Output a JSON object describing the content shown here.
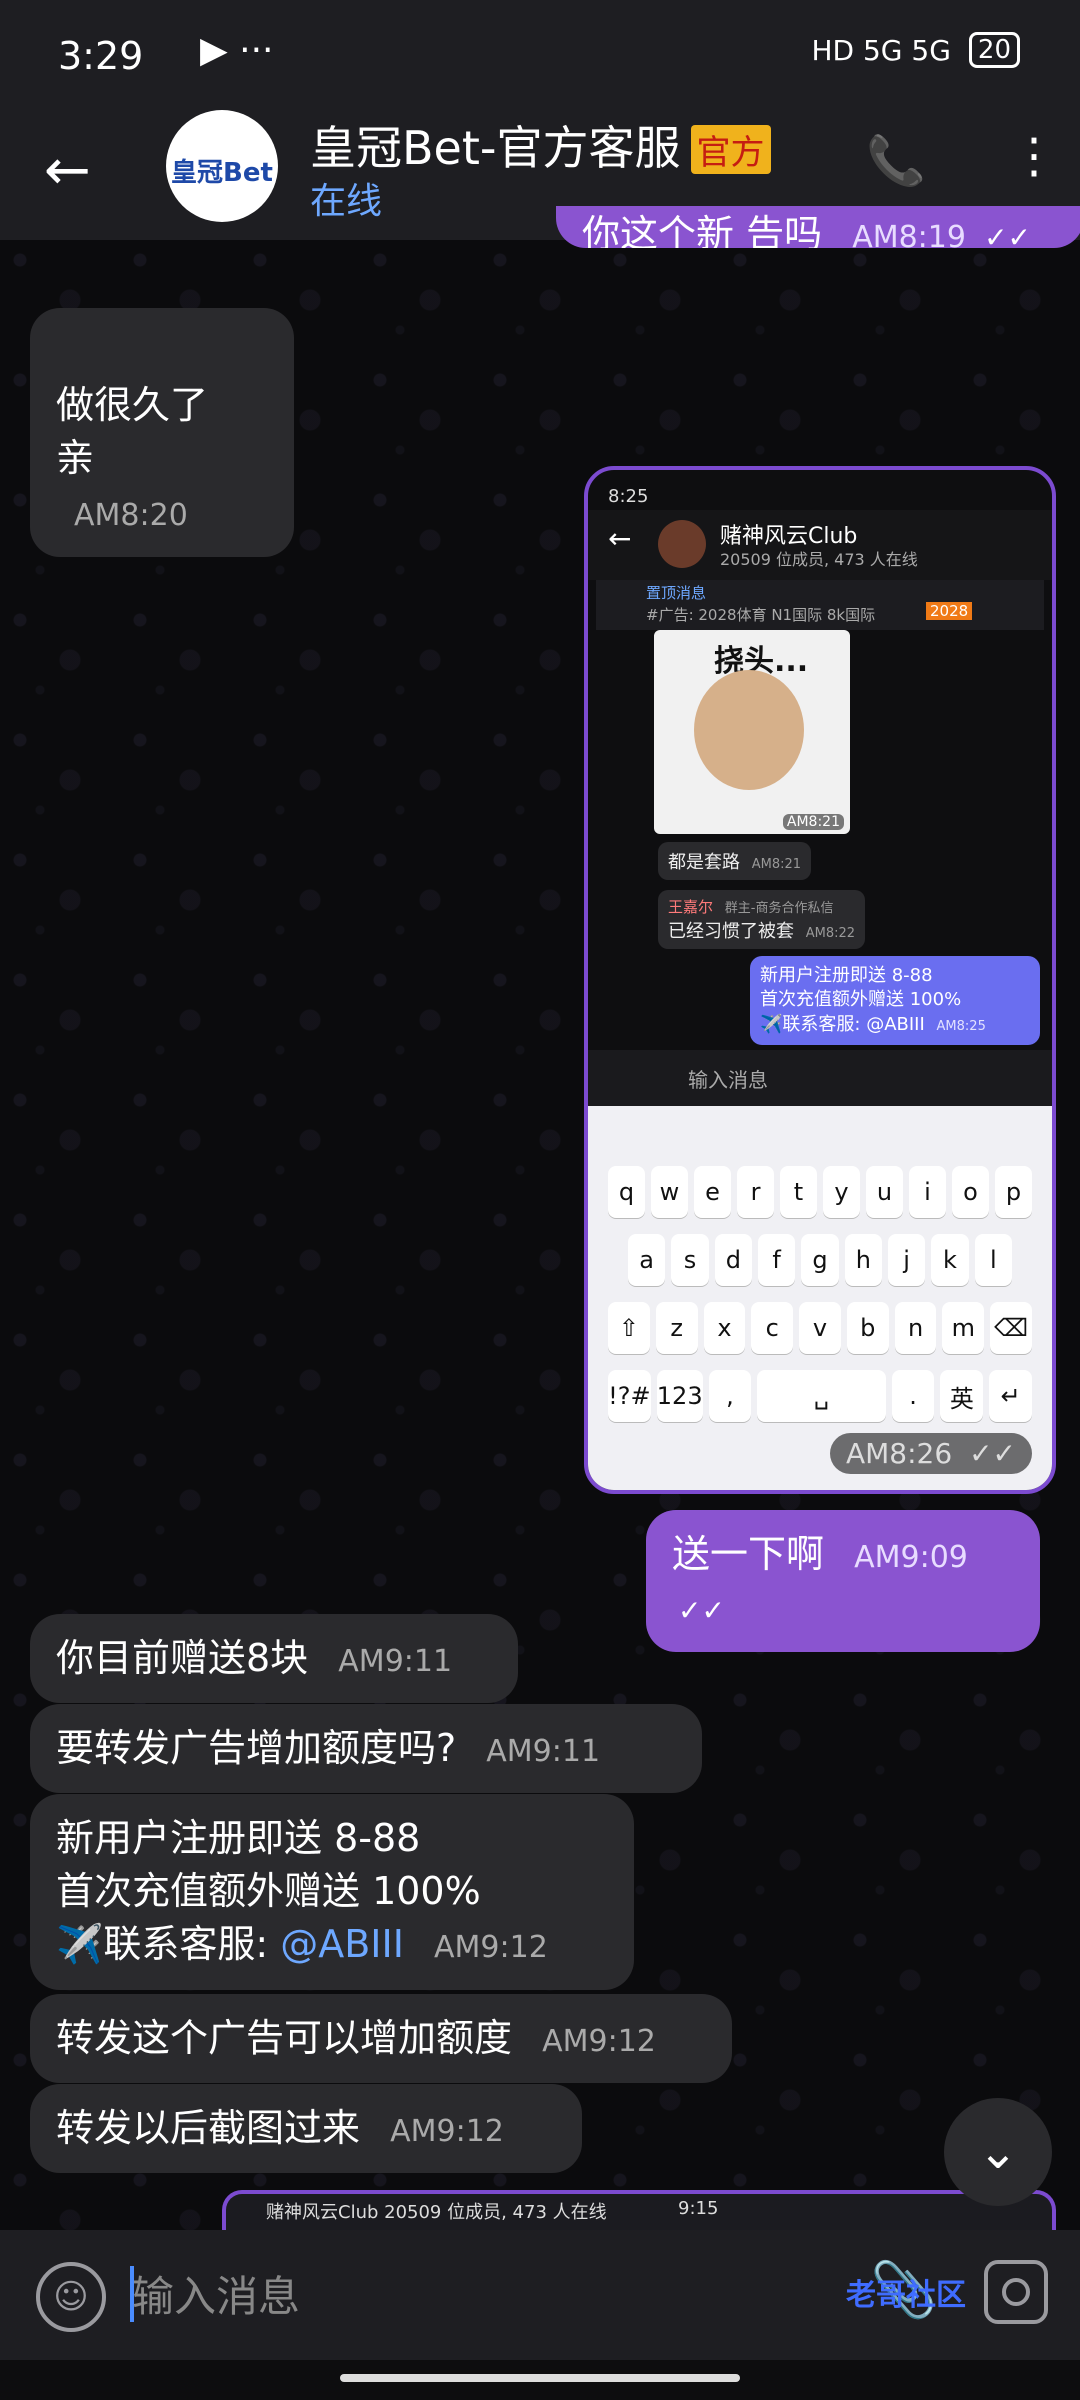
{
  "status": {
    "time": "3:29",
    "dots": "▶ ···",
    "signal": "HD 5G 5G",
    "battery": "20"
  },
  "header": {
    "avatar_text": "皇冠Bet",
    "title": "皇冠Bet-官方客服",
    "official_badge": "官方",
    "status": "在线"
  },
  "messages": [
    {
      "text": "你这个新 告吗",
      "time": "AM8:19",
      "outgoing": true,
      "check": "✓✓"
    },
    {
      "text": "做很久了\n亲",
      "time": "AM8:20",
      "outgoing": false
    },
    {
      "text": "送一下啊",
      "time": "AM9:09",
      "outgoing": true,
      "check": "✓✓"
    },
    {
      "text": "你目前赠送8块",
      "time": "AM9:11",
      "outgoing": false
    },
    {
      "text": "要转发广告增加额度吗?",
      "time": "AM9:11",
      "outgoing": false
    },
    {
      "line1": "新用户注册即送 8-88",
      "line2": "首次充值额外赠送 100%",
      "line3": "✈️联系客服:",
      "link": "@ABIII",
      "time": "AM9:12",
      "outgoing": false
    },
    {
      "text": "转发这个广告可以增加额度",
      "time": "AM9:12",
      "outgoing": false
    },
    {
      "text": "转发以后截图过来",
      "time": "AM9:12",
      "outgoing": false
    }
  ],
  "screenshot": {
    "status_time": "8:25",
    "group_name": "赌神风云Club",
    "group_sub": "20509 位成员, 473 人在线",
    "pinned_title": "置顶消息",
    "pinned_text": "#广告: 2028体育  N1国际  8k国际",
    "pinned_badge": "2028",
    "meme_text": "挠头...",
    "meme_time": "AM8:21",
    "msg1": "都是套路",
    "msg1_time": "AM8:21",
    "msg2_name": "王嘉尔",
    "msg2_role": "群主-商务合作私信",
    "msg2_text": "已经习惯了被套",
    "msg2_time": "AM8:22",
    "out_line1": "新用户注册即送 8-88",
    "out_line2": "首次充值额外赠送 100%",
    "out_line3": "✈️联系客服: @ABIII",
    "out_time": "AM8:25",
    "input_placeholder": "输入消息",
    "keys_row1": [
      "q",
      "w",
      "e",
      "r",
      "t",
      "y",
      "u",
      "i",
      "o",
      "p"
    ],
    "keys_row2": [
      "a",
      "s",
      "d",
      "f",
      "g",
      "h",
      "j",
      "k",
      "l"
    ],
    "keys_row3": [
      "⇧",
      "z",
      "x",
      "c",
      "v",
      "b",
      "n",
      "m",
      "⌫"
    ],
    "keys_row4": [
      "!?#",
      "123",
      ",",
      "␣",
      ".",
      "英",
      "↵"
    ],
    "time": "AM8:26",
    "check": "✓✓"
  },
  "preview_strip": {
    "left": "赌神风云Club  20509 位成员, 473 人在线",
    "right": "9:15"
  },
  "input": {
    "placeholder": "输入消息"
  },
  "watermark": "老哥社区"
}
